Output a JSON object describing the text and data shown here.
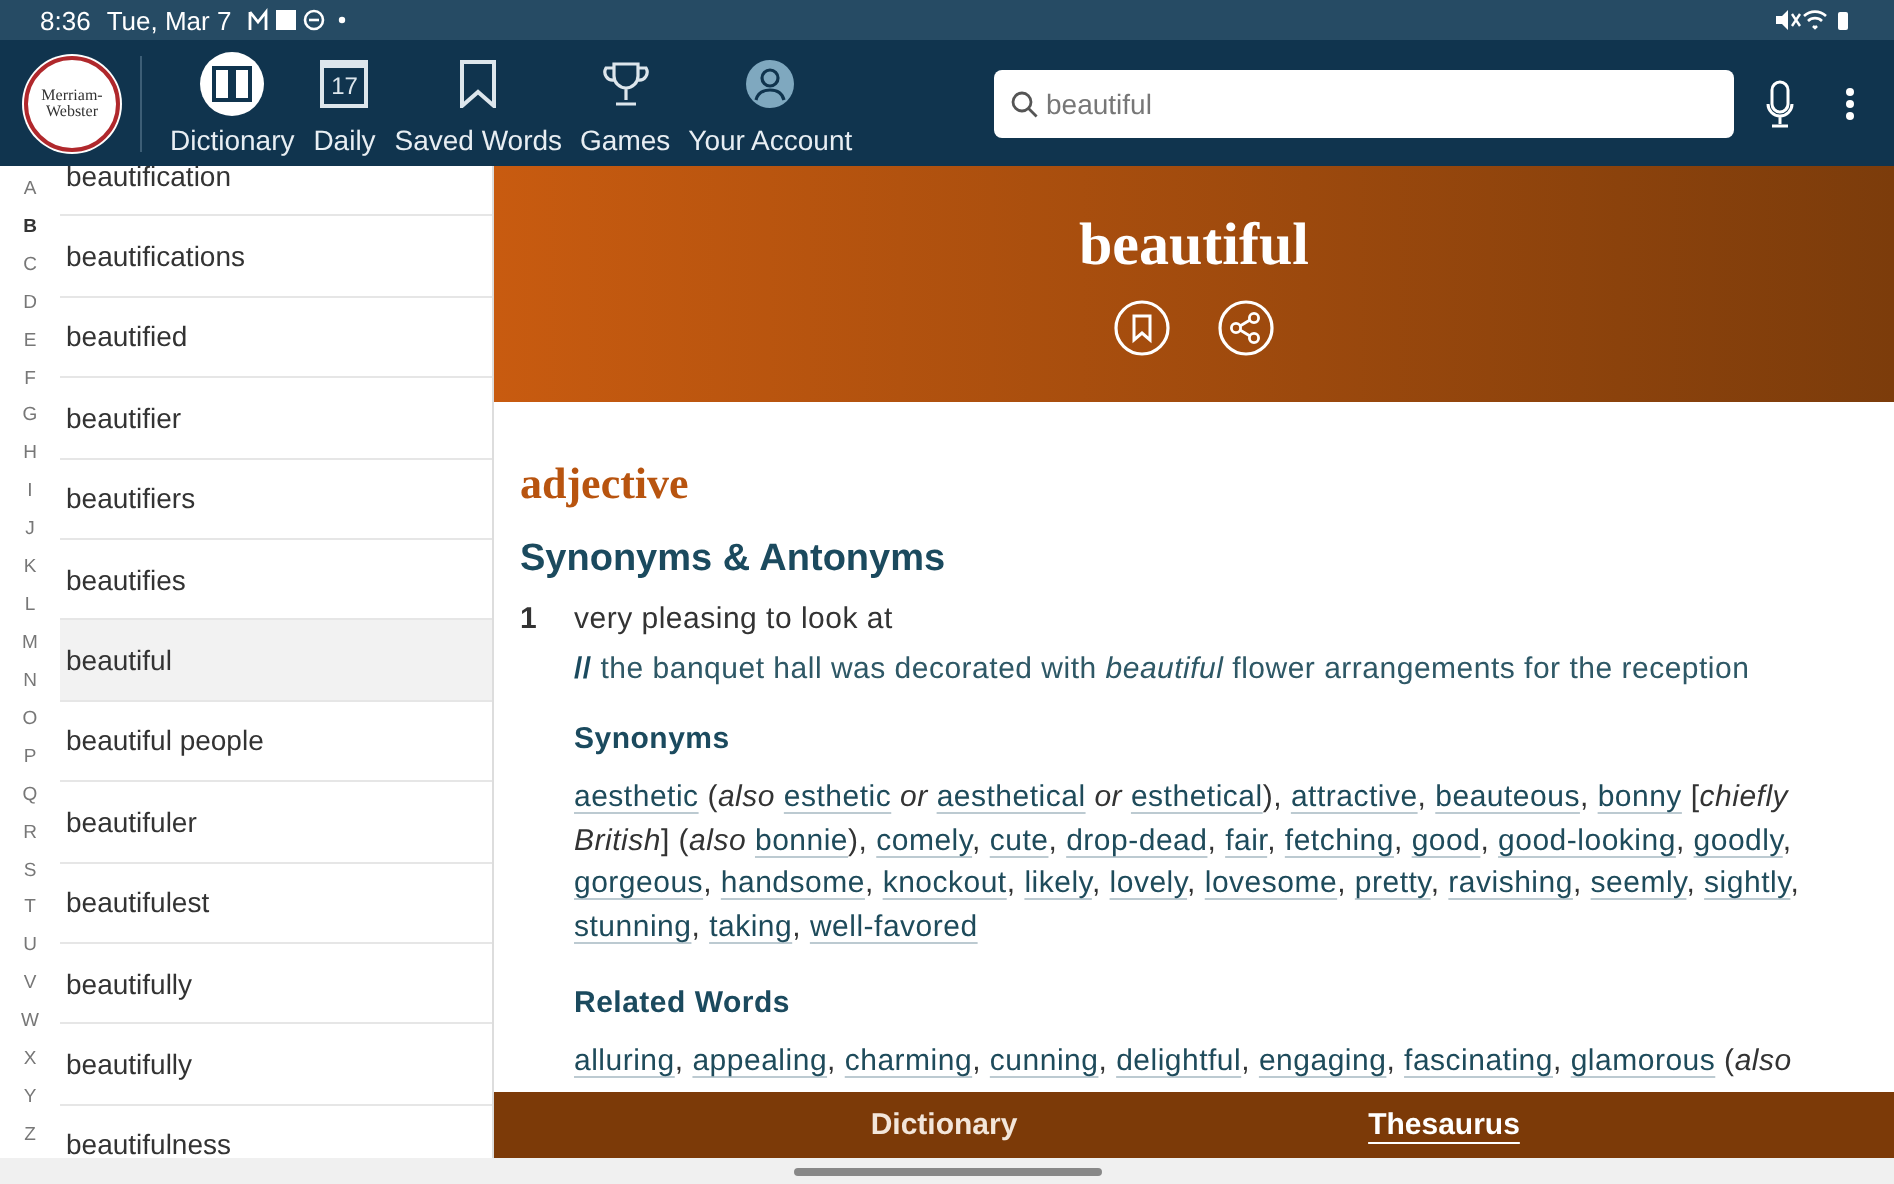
{
  "status_bar": {
    "time": "8:36",
    "date": "Tue, Mar 7"
  },
  "logo": {
    "lines": [
      "Merriam-",
      "Webster"
    ]
  },
  "nav": [
    {
      "kind": "dictionary",
      "label": "Dictionary",
      "selected": true
    },
    {
      "kind": "daily",
      "label": "Daily",
      "icon_text": "17",
      "selected": false
    },
    {
      "kind": "saved",
      "label": "Saved Words",
      "selected": false
    },
    {
      "kind": "games",
      "label": "Games",
      "selected": false
    },
    {
      "kind": "account",
      "label": "Your Account",
      "selected": false
    }
  ],
  "search": {
    "value": "beautiful"
  },
  "alphabet": [
    {
      "letter": "A",
      "selected": false
    },
    {
      "letter": "B",
      "selected": true
    },
    {
      "letter": "C",
      "selected": false
    },
    {
      "letter": "D",
      "selected": false
    },
    {
      "letter": "E",
      "selected": false
    },
    {
      "letter": "F",
      "selected": false
    },
    {
      "letter": "G",
      "selected": false
    },
    {
      "letter": "H",
      "selected": false
    },
    {
      "letter": "I",
      "selected": false
    },
    {
      "letter": "J",
      "selected": false
    },
    {
      "letter": "K",
      "selected": false
    },
    {
      "letter": "L",
      "selected": false
    },
    {
      "letter": "M",
      "selected": false
    },
    {
      "letter": "N",
      "selected": false
    },
    {
      "letter": "O",
      "selected": false
    },
    {
      "letter": "P",
      "selected": false
    },
    {
      "letter": "Q",
      "selected": false
    },
    {
      "letter": "R",
      "selected": false
    },
    {
      "letter": "S",
      "selected": false
    },
    {
      "letter": "T",
      "selected": false
    },
    {
      "letter": "U",
      "selected": false
    },
    {
      "letter": "V",
      "selected": false
    },
    {
      "letter": "W",
      "selected": false
    },
    {
      "letter": "X",
      "selected": false
    },
    {
      "letter": "Y",
      "selected": false
    },
    {
      "letter": "Z",
      "selected": false
    }
  ],
  "word_list": [
    {
      "word": "beautification",
      "selected": false
    },
    {
      "word": "beautifications",
      "selected": false
    },
    {
      "word": "beautified",
      "selected": false
    },
    {
      "word": "beautifier",
      "selected": false
    },
    {
      "word": "beautifiers",
      "selected": false
    },
    {
      "word": "beautifies",
      "selected": false
    },
    {
      "word": "beautiful",
      "selected": true
    },
    {
      "word": "beautiful people",
      "selected": false
    },
    {
      "word": "beautifuler",
      "selected": false
    },
    {
      "word": "beautifulest",
      "selected": false
    },
    {
      "word": "beautifully",
      "selected": false
    },
    {
      "word": "beautifully",
      "selected": false
    },
    {
      "word": "beautifulness",
      "selected": false
    }
  ],
  "entry": {
    "headword": "beautiful",
    "part_of_speech": "adjective",
    "section_title": "Synonyms & Antonyms",
    "sense": {
      "number": "1",
      "definition": "very pleasing to look at",
      "example_mark": "//",
      "example": "the banquet hall was decorated with *beautiful* flower arrangements for the reception"
    },
    "groups": [
      {
        "title": "Synonyms",
        "segments": [
          {
            "kind": "link",
            "text": "aesthetic"
          },
          {
            "kind": "text",
            "text": " (*also* "
          },
          {
            "kind": "link",
            "text": "esthetic"
          },
          {
            "kind": "text",
            "text": " *or* "
          },
          {
            "kind": "link",
            "text": "aesthetical"
          },
          {
            "kind": "text",
            "text": " *or* "
          },
          {
            "kind": "link",
            "text": "esthetical"
          },
          {
            "kind": "text",
            "text": "), "
          },
          {
            "kind": "link",
            "text": "attractive"
          },
          {
            "kind": "text",
            "text": ", "
          },
          {
            "kind": "link",
            "text": "beauteous"
          },
          {
            "kind": "text",
            "text": ", "
          },
          {
            "kind": "link",
            "text": "bonny"
          },
          {
            "kind": "text",
            "text": " [*chiefly British*] (*also* "
          },
          {
            "kind": "link",
            "text": "bonnie"
          },
          {
            "kind": "text",
            "text": "), "
          },
          {
            "kind": "link",
            "text": "comely"
          },
          {
            "kind": "text",
            "text": ", "
          },
          {
            "kind": "link",
            "text": "cute"
          },
          {
            "kind": "text",
            "text": ", "
          },
          {
            "kind": "link",
            "text": "drop-dead"
          },
          {
            "kind": "text",
            "text": ", "
          },
          {
            "kind": "link",
            "text": "fair"
          },
          {
            "kind": "text",
            "text": ", "
          },
          {
            "kind": "link",
            "text": "fetching"
          },
          {
            "kind": "text",
            "text": ", "
          },
          {
            "kind": "link",
            "text": "good"
          },
          {
            "kind": "text",
            "text": ", "
          },
          {
            "kind": "link",
            "text": "good-looking"
          },
          {
            "kind": "text",
            "text": ", "
          },
          {
            "kind": "link",
            "text": "goodly"
          },
          {
            "kind": "text",
            "text": ", "
          },
          {
            "kind": "link",
            "text": "gorgeous"
          },
          {
            "kind": "text",
            "text": ", "
          },
          {
            "kind": "link",
            "text": "handsome"
          },
          {
            "kind": "text",
            "text": ", "
          },
          {
            "kind": "link",
            "text": "knockout"
          },
          {
            "kind": "text",
            "text": ", "
          },
          {
            "kind": "link",
            "text": "likely"
          },
          {
            "kind": "text",
            "text": ", "
          },
          {
            "kind": "link",
            "text": "lovely"
          },
          {
            "kind": "text",
            "text": ", "
          },
          {
            "kind": "link",
            "text": "lovesome"
          },
          {
            "kind": "text",
            "text": ", "
          },
          {
            "kind": "link",
            "text": "pretty"
          },
          {
            "kind": "text",
            "text": ", "
          },
          {
            "kind": "link",
            "text": "ravishing"
          },
          {
            "kind": "text",
            "text": ", "
          },
          {
            "kind": "link",
            "text": "seemly"
          },
          {
            "kind": "text",
            "text": ", "
          },
          {
            "kind": "link",
            "text": "sightly"
          },
          {
            "kind": "text",
            "text": ", "
          },
          {
            "kind": "link",
            "text": "stunning"
          },
          {
            "kind": "text",
            "text": ", "
          },
          {
            "kind": "link",
            "text": "taking"
          },
          {
            "kind": "text",
            "text": ", "
          },
          {
            "kind": "link",
            "text": "well-favored"
          }
        ]
      },
      {
        "title": "Related Words",
        "segments": [
          {
            "kind": "link",
            "text": "alluring"
          },
          {
            "kind": "text",
            "text": ", "
          },
          {
            "kind": "link",
            "text": "appealing"
          },
          {
            "kind": "text",
            "text": ", "
          },
          {
            "kind": "link",
            "text": "charming"
          },
          {
            "kind": "text",
            "text": ", "
          },
          {
            "kind": "link",
            "text": "cunning"
          },
          {
            "kind": "text",
            "text": ", "
          },
          {
            "kind": "link",
            "text": "delightful"
          },
          {
            "kind": "text",
            "text": ", "
          },
          {
            "kind": "link",
            "text": "engaging"
          },
          {
            "kind": "text",
            "text": ", "
          },
          {
            "kind": "link",
            "text": "fascinating"
          },
          {
            "kind": "text",
            "text": ", "
          },
          {
            "kind": "link",
            "text": "glamorous"
          },
          {
            "kind": "text",
            "text": " (*also*"
          }
        ]
      }
    ]
  },
  "bottom_tabs": [
    {
      "label": "Dictionary",
      "selected": false
    },
    {
      "label": "Thesaurus",
      "selected": true
    }
  ]
}
